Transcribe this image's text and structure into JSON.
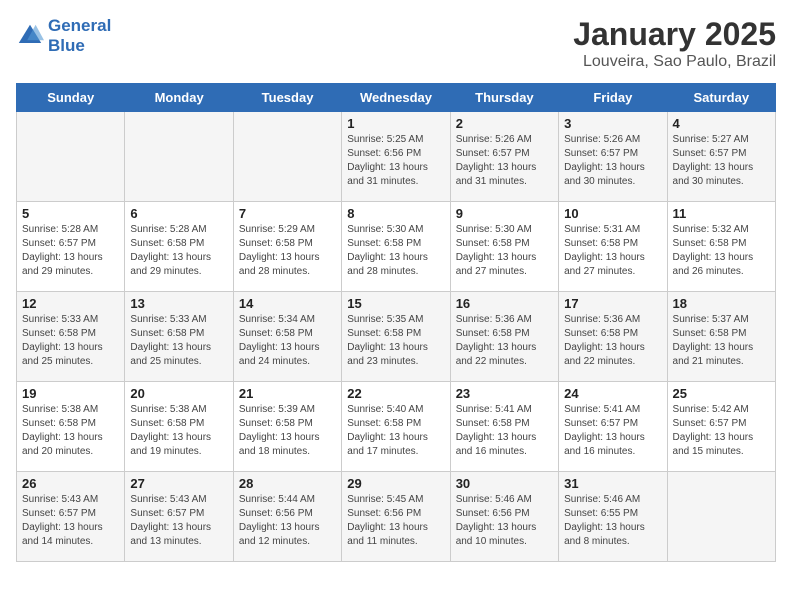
{
  "header": {
    "logo_line1": "General",
    "logo_line2": "Blue",
    "title": "January 2025",
    "subtitle": "Louveira, Sao Paulo, Brazil"
  },
  "days_of_week": [
    "Sunday",
    "Monday",
    "Tuesday",
    "Wednesday",
    "Thursday",
    "Friday",
    "Saturday"
  ],
  "weeks": [
    [
      {
        "day": "",
        "sunrise": "",
        "sunset": "",
        "daylight": ""
      },
      {
        "day": "",
        "sunrise": "",
        "sunset": "",
        "daylight": ""
      },
      {
        "day": "",
        "sunrise": "",
        "sunset": "",
        "daylight": ""
      },
      {
        "day": "1",
        "sunrise": "Sunrise: 5:25 AM",
        "sunset": "Sunset: 6:56 PM",
        "daylight": "Daylight: 13 hours and 31 minutes."
      },
      {
        "day": "2",
        "sunrise": "Sunrise: 5:26 AM",
        "sunset": "Sunset: 6:57 PM",
        "daylight": "Daylight: 13 hours and 31 minutes."
      },
      {
        "day": "3",
        "sunrise": "Sunrise: 5:26 AM",
        "sunset": "Sunset: 6:57 PM",
        "daylight": "Daylight: 13 hours and 30 minutes."
      },
      {
        "day": "4",
        "sunrise": "Sunrise: 5:27 AM",
        "sunset": "Sunset: 6:57 PM",
        "daylight": "Daylight: 13 hours and 30 minutes."
      }
    ],
    [
      {
        "day": "5",
        "sunrise": "Sunrise: 5:28 AM",
        "sunset": "Sunset: 6:57 PM",
        "daylight": "Daylight: 13 hours and 29 minutes."
      },
      {
        "day": "6",
        "sunrise": "Sunrise: 5:28 AM",
        "sunset": "Sunset: 6:58 PM",
        "daylight": "Daylight: 13 hours and 29 minutes."
      },
      {
        "day": "7",
        "sunrise": "Sunrise: 5:29 AM",
        "sunset": "Sunset: 6:58 PM",
        "daylight": "Daylight: 13 hours and 28 minutes."
      },
      {
        "day": "8",
        "sunrise": "Sunrise: 5:30 AM",
        "sunset": "Sunset: 6:58 PM",
        "daylight": "Daylight: 13 hours and 28 minutes."
      },
      {
        "day": "9",
        "sunrise": "Sunrise: 5:30 AM",
        "sunset": "Sunset: 6:58 PM",
        "daylight": "Daylight: 13 hours and 27 minutes."
      },
      {
        "day": "10",
        "sunrise": "Sunrise: 5:31 AM",
        "sunset": "Sunset: 6:58 PM",
        "daylight": "Daylight: 13 hours and 27 minutes."
      },
      {
        "day": "11",
        "sunrise": "Sunrise: 5:32 AM",
        "sunset": "Sunset: 6:58 PM",
        "daylight": "Daylight: 13 hours and 26 minutes."
      }
    ],
    [
      {
        "day": "12",
        "sunrise": "Sunrise: 5:33 AM",
        "sunset": "Sunset: 6:58 PM",
        "daylight": "Daylight: 13 hours and 25 minutes."
      },
      {
        "day": "13",
        "sunrise": "Sunrise: 5:33 AM",
        "sunset": "Sunset: 6:58 PM",
        "daylight": "Daylight: 13 hours and 25 minutes."
      },
      {
        "day": "14",
        "sunrise": "Sunrise: 5:34 AM",
        "sunset": "Sunset: 6:58 PM",
        "daylight": "Daylight: 13 hours and 24 minutes."
      },
      {
        "day": "15",
        "sunrise": "Sunrise: 5:35 AM",
        "sunset": "Sunset: 6:58 PM",
        "daylight": "Daylight: 13 hours and 23 minutes."
      },
      {
        "day": "16",
        "sunrise": "Sunrise: 5:36 AM",
        "sunset": "Sunset: 6:58 PM",
        "daylight": "Daylight: 13 hours and 22 minutes."
      },
      {
        "day": "17",
        "sunrise": "Sunrise: 5:36 AM",
        "sunset": "Sunset: 6:58 PM",
        "daylight": "Daylight: 13 hours and 22 minutes."
      },
      {
        "day": "18",
        "sunrise": "Sunrise: 5:37 AM",
        "sunset": "Sunset: 6:58 PM",
        "daylight": "Daylight: 13 hours and 21 minutes."
      }
    ],
    [
      {
        "day": "19",
        "sunrise": "Sunrise: 5:38 AM",
        "sunset": "Sunset: 6:58 PM",
        "daylight": "Daylight: 13 hours and 20 minutes."
      },
      {
        "day": "20",
        "sunrise": "Sunrise: 5:38 AM",
        "sunset": "Sunset: 6:58 PM",
        "daylight": "Daylight: 13 hours and 19 minutes."
      },
      {
        "day": "21",
        "sunrise": "Sunrise: 5:39 AM",
        "sunset": "Sunset: 6:58 PM",
        "daylight": "Daylight: 13 hours and 18 minutes."
      },
      {
        "day": "22",
        "sunrise": "Sunrise: 5:40 AM",
        "sunset": "Sunset: 6:58 PM",
        "daylight": "Daylight: 13 hours and 17 minutes."
      },
      {
        "day": "23",
        "sunrise": "Sunrise: 5:41 AM",
        "sunset": "Sunset: 6:58 PM",
        "daylight": "Daylight: 13 hours and 16 minutes."
      },
      {
        "day": "24",
        "sunrise": "Sunrise: 5:41 AM",
        "sunset": "Sunset: 6:57 PM",
        "daylight": "Daylight: 13 hours and 16 minutes."
      },
      {
        "day": "25",
        "sunrise": "Sunrise: 5:42 AM",
        "sunset": "Sunset: 6:57 PM",
        "daylight": "Daylight: 13 hours and 15 minutes."
      }
    ],
    [
      {
        "day": "26",
        "sunrise": "Sunrise: 5:43 AM",
        "sunset": "Sunset: 6:57 PM",
        "daylight": "Daylight: 13 hours and 14 minutes."
      },
      {
        "day": "27",
        "sunrise": "Sunrise: 5:43 AM",
        "sunset": "Sunset: 6:57 PM",
        "daylight": "Daylight: 13 hours and 13 minutes."
      },
      {
        "day": "28",
        "sunrise": "Sunrise: 5:44 AM",
        "sunset": "Sunset: 6:56 PM",
        "daylight": "Daylight: 13 hours and 12 minutes."
      },
      {
        "day": "29",
        "sunrise": "Sunrise: 5:45 AM",
        "sunset": "Sunset: 6:56 PM",
        "daylight": "Daylight: 13 hours and 11 minutes."
      },
      {
        "day": "30",
        "sunrise": "Sunrise: 5:46 AM",
        "sunset": "Sunset: 6:56 PM",
        "daylight": "Daylight: 13 hours and 10 minutes."
      },
      {
        "day": "31",
        "sunrise": "Sunrise: 5:46 AM",
        "sunset": "Sunset: 6:55 PM",
        "daylight": "Daylight: 13 hours and 8 minutes."
      },
      {
        "day": "",
        "sunrise": "",
        "sunset": "",
        "daylight": ""
      }
    ]
  ],
  "colors": {
    "header_bg": "#2f6cb5",
    "odd_row": "#f5f5f5",
    "even_row": "#ffffff"
  }
}
